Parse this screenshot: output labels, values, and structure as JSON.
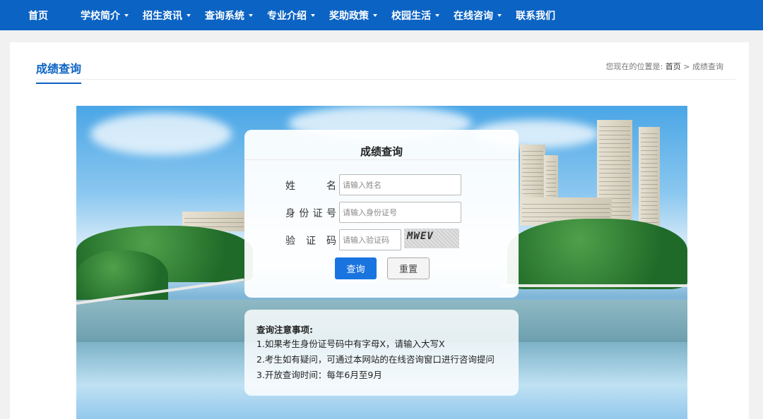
{
  "nav": {
    "items": [
      {
        "label": "首页",
        "dropdown": false
      },
      {
        "label": "学校简介",
        "dropdown": true
      },
      {
        "label": "招生资讯",
        "dropdown": true
      },
      {
        "label": "查询系统",
        "dropdown": true
      },
      {
        "label": "专业介绍",
        "dropdown": true
      },
      {
        "label": "奖助政策",
        "dropdown": true
      },
      {
        "label": "校园生活",
        "dropdown": true
      },
      {
        "label": "在线咨询",
        "dropdown": true
      },
      {
        "label": "联系我们",
        "dropdown": false
      }
    ]
  },
  "page": {
    "title": "成绩查询",
    "breadcrumb": {
      "prefix": "您现在的位置是:",
      "home": "首页",
      "separator": ">",
      "current": "成绩查询"
    }
  },
  "form": {
    "title": "成绩查询",
    "name_label": "姓名",
    "name_placeholder": "请输入姓名",
    "id_label": "身份证号",
    "id_placeholder": "请输入身份证号",
    "captcha_label": "验证码",
    "captcha_placeholder": "请输入验证码",
    "captcha_text": "MWEV",
    "submit_label": "查询",
    "reset_label": "重置"
  },
  "notes": {
    "title": "查询注意事项:",
    "items": [
      "1.如果考生身份证号码中有字母X，请输入大写X",
      "2.考生如有疑问，可通过本网站的在线咨询窗口进行咨询提问",
      "3.开放查询时间：每年6月至9月"
    ]
  },
  "colors": {
    "nav_bg": "#0b63c3",
    "accent": "#0b63c3",
    "button_primary": "#1a74e0"
  }
}
